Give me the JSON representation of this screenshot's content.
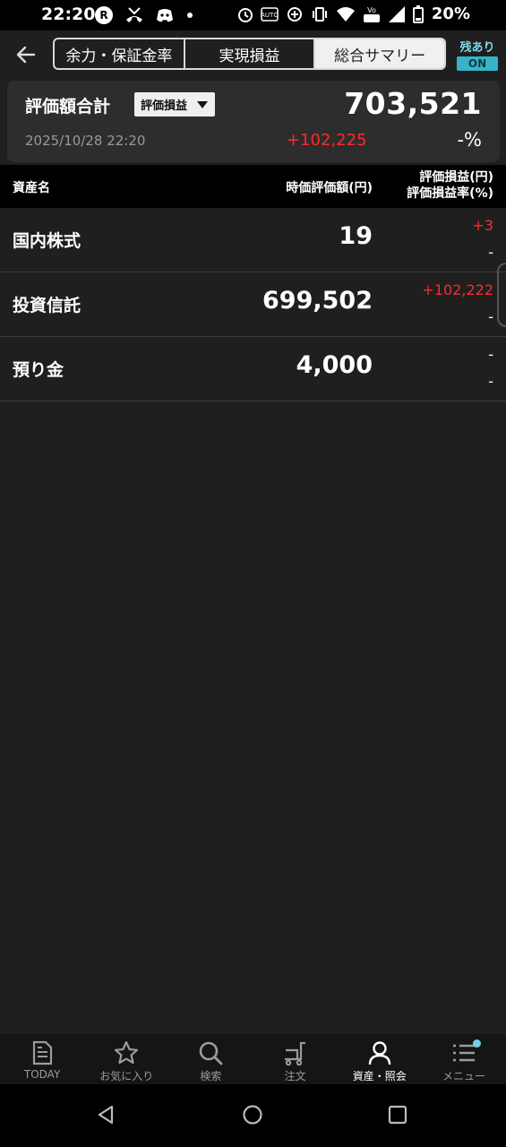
{
  "status_bar": {
    "time": "22:20",
    "battery": "20%",
    "icons": [
      "rakuten-icon",
      "missed-call-icon",
      "discord-icon",
      "dot-icon",
      "alarm-icon",
      "auto-brightness-icon",
      "data-saver-icon",
      "vibrate-icon",
      "wifi-icon",
      "volte-icon",
      "signal-icon",
      "battery-icon"
    ]
  },
  "header": {
    "tabs": [
      {
        "label": "余力・保証金率",
        "active": false
      },
      {
        "label": "実現損益",
        "active": false
      },
      {
        "label": "総合サマリー",
        "active": true
      }
    ],
    "zandaka_label": "残あり",
    "zandaka_state": "ON"
  },
  "summary": {
    "title": "評価額合計",
    "dropdown": "評価損益",
    "total": "703,521",
    "datetime": "2025/10/28  22:20",
    "gain": "+102,225",
    "rate": "-%"
  },
  "table": {
    "col_name": "資産名",
    "col_value": "時価評価額(円)",
    "col_gain": "評価損益(円)",
    "col_rate": "評価損益率(%)",
    "rows": [
      {
        "name": "国内株式",
        "value": "19",
        "gain": "+3",
        "rate": "-"
      },
      {
        "name": "投資信託",
        "value": "699,502",
        "gain": "+102,222",
        "rate": "-"
      },
      {
        "name": "預り金",
        "value": "4,000",
        "gain": "-",
        "rate": "-"
      }
    ]
  },
  "bottom_nav": [
    {
      "label": "TODAY",
      "icon": "document-icon",
      "active": false
    },
    {
      "label": "お気に入り",
      "icon": "star-icon",
      "active": false
    },
    {
      "label": "検索",
      "icon": "search-icon",
      "active": false
    },
    {
      "label": "注文",
      "icon": "cart-icon",
      "active": false
    },
    {
      "label": "資産・照会",
      "icon": "person-icon",
      "active": true
    },
    {
      "label": "メニュー",
      "icon": "list-menu-icon",
      "active": false
    }
  ]
}
